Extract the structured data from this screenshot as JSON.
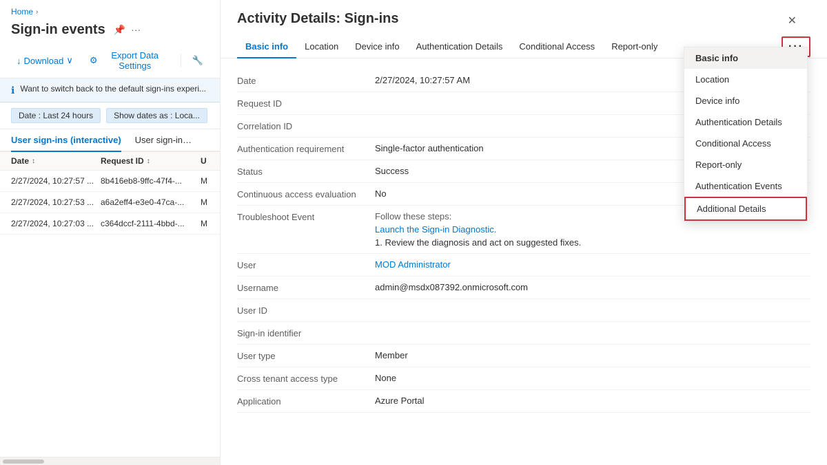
{
  "sidebar": {
    "breadcrumb_home": "Home",
    "title": "Sign-in events",
    "pin_icon": "📌",
    "more_icon": "···",
    "download_label": "Download",
    "export_label": "Export Data Settings",
    "tools_icon": "🔧",
    "info_text": "Want to switch back to the default sign-ins experi...",
    "filter_date": "Date : Last 24 hours",
    "filter_show": "Show dates as : Loca...",
    "tab_interactive": "User sign-ins (interactive)",
    "tab_noninteractive": "User sign-ins (non...",
    "col_date": "Date",
    "col_reqid": "Request ID",
    "col_other": "U",
    "rows": [
      {
        "date": "2/27/2024, 10:27:57 ...",
        "reqid": "8b416eb8-9ffc-47f4-...",
        "other": "M"
      },
      {
        "date": "2/27/2024, 10:27:53 ...",
        "reqid": "a6a2eff4-e3e0-47ca-...",
        "other": "M"
      },
      {
        "date": "2/27/2024, 10:27:03 ...",
        "reqid": "c364dccf-2111-4bbd-...",
        "other": "M"
      }
    ]
  },
  "panel": {
    "title": "Activity Details: Sign-ins",
    "close_icon": "✕",
    "tabs": [
      {
        "label": "Basic info",
        "active": true
      },
      {
        "label": "Location",
        "active": false
      },
      {
        "label": "Device info",
        "active": false
      },
      {
        "label": "Authentication Details",
        "active": false
      },
      {
        "label": "Conditional Access",
        "active": false
      },
      {
        "label": "Report-only",
        "active": false
      }
    ],
    "more_btn": "···",
    "fields": [
      {
        "label": "Date",
        "value": "2/27/2024, 10:27:57 AM",
        "link": false
      },
      {
        "label": "Request ID",
        "value": "",
        "link": false
      },
      {
        "label": "Correlation ID",
        "value": "",
        "link": false
      },
      {
        "label": "Authentication requirement",
        "value": "Single-factor authentication",
        "link": false
      },
      {
        "label": "Status",
        "value": "Success",
        "link": false
      },
      {
        "label": "Continuous access evaluation",
        "value": "No",
        "link": false
      },
      {
        "label": "Troubleshoot Event",
        "value": "",
        "link": false,
        "special": true
      },
      {
        "label": "User",
        "value": "MOD Administrator",
        "link": true
      },
      {
        "label": "Username",
        "value": "admin@msdx087392.onmicrosoft.com",
        "link": false
      },
      {
        "label": "User ID",
        "value": "",
        "link": false
      },
      {
        "label": "Sign-in identifier",
        "value": "",
        "link": false
      },
      {
        "label": "User type",
        "value": "Member",
        "link": false
      },
      {
        "label": "Cross tenant access type",
        "value": "None",
        "link": false
      },
      {
        "label": "Application",
        "value": "Azure Portal",
        "link": false
      }
    ],
    "troubleshoot_steps_label": "Follow these steps:",
    "troubleshoot_link": "Launch the Sign-in Diagnostic.",
    "troubleshoot_step1": "1. Review the diagnosis and act on suggested fixes."
  },
  "dropdown": {
    "items": [
      {
        "label": "Basic info",
        "selected": true,
        "highlighted": false
      },
      {
        "label": "Location",
        "selected": false,
        "highlighted": false
      },
      {
        "label": "Device info",
        "selected": false,
        "highlighted": false
      },
      {
        "label": "Authentication Details",
        "selected": false,
        "highlighted": false
      },
      {
        "label": "Conditional Access",
        "selected": false,
        "highlighted": false
      },
      {
        "label": "Report-only",
        "selected": false,
        "highlighted": false
      },
      {
        "label": "Authentication Events",
        "selected": false,
        "highlighted": false
      },
      {
        "label": "Additional Details",
        "selected": false,
        "highlighted": true
      }
    ]
  }
}
